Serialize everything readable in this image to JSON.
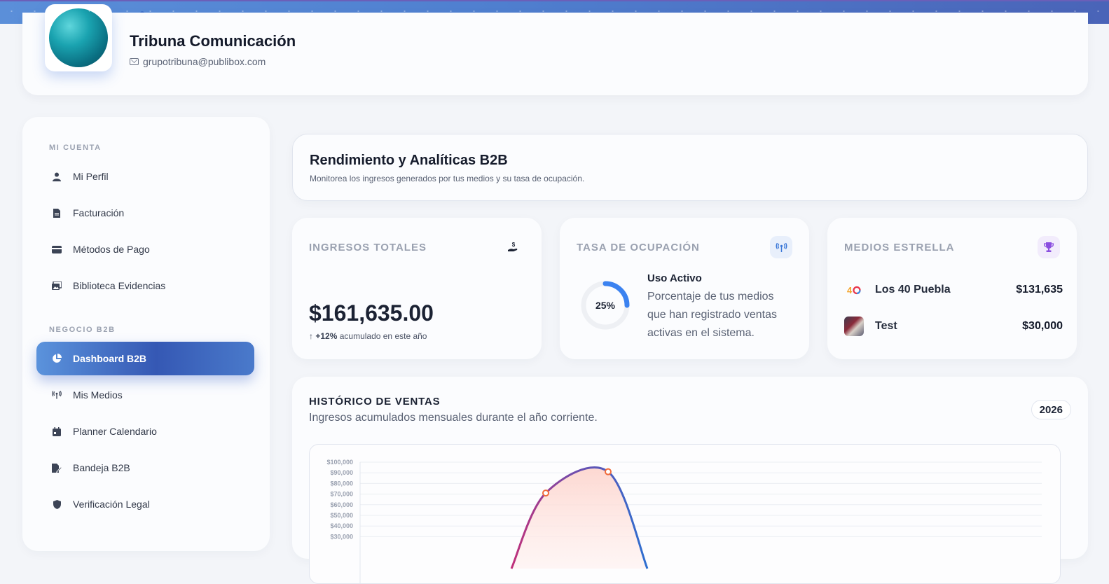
{
  "profile": {
    "name": "Tribuna Comunicación",
    "email": "grupotribuna@publibox.com"
  },
  "sidebar": {
    "sections": [
      {
        "label": "MI CUENTA"
      },
      {
        "label": "NEGOCIO B2B"
      }
    ],
    "items": [
      {
        "label": "Mi Perfil",
        "icon": "user-icon"
      },
      {
        "label": "Facturación",
        "icon": "document-icon"
      },
      {
        "label": "Métodos de Pago",
        "icon": "credit-card-icon"
      },
      {
        "label": "Biblioteca Evidencias",
        "icon": "images-icon"
      },
      {
        "label": "Dashboard B2B",
        "icon": "pie-chart-icon",
        "active": true
      },
      {
        "label": "Mis Medios",
        "icon": "broadcast-icon"
      },
      {
        "label": "Planner Calendario",
        "icon": "calendar-icon"
      },
      {
        "label": "Bandeja B2B",
        "icon": "edit-document-icon"
      },
      {
        "label": "Verificación Legal",
        "icon": "shield-icon"
      }
    ]
  },
  "header": {
    "title": "Rendimiento y Analíticas B2B",
    "subtitle": "Monitorea los ingresos generados por tus medios y su tasa de ocupación."
  },
  "stats": {
    "income": {
      "title": "INGRESOS TOTALES",
      "icon": "hand-money-icon",
      "amount": "$161,635.00",
      "growth_value": "+12%",
      "growth_text": "acumulado en este año"
    },
    "occupancy": {
      "title": "TASA DE OCUPACIÓN",
      "icon": "broadcast-icon",
      "percent_label": "25%",
      "percent_value": 0.25,
      "subtitle": "Uso Activo",
      "description": "Porcentaje de tus medios que han registrado ventas activas en el sistema."
    },
    "stars": {
      "title": "MEDIOS ESTRELLA",
      "icon": "trophy-icon",
      "items": [
        {
          "name": "Los 40 Puebla",
          "value": "$131,635",
          "logo": "40"
        },
        {
          "name": "Test",
          "value": "$30,000",
          "logo": ""
        }
      ]
    }
  },
  "sales": {
    "title": "HISTÓRICO DE VENTAS",
    "subtitle": "Ingresos acumulados mensuales durante el año corriente.",
    "year": "2026"
  },
  "chart_data": {
    "type": "area",
    "title": "",
    "xlabel": "",
    "ylabel": "",
    "ylim": [
      0,
      100000
    ],
    "y_ticks": [
      "$100,000",
      "$90,000",
      "$80,000",
      "$70,000",
      "$60,000",
      "$50,000",
      "$40,000",
      "$30,000"
    ],
    "y_tick_values": [
      100000,
      90000,
      80000,
      70000,
      60000,
      50000,
      40000,
      30000
    ],
    "points": [
      {
        "x": 0.0,
        "y": 0
      },
      {
        "x": 1.0,
        "y": 71000
      },
      {
        "x": 2.0,
        "y": 91000
      },
      {
        "x": 3.0,
        "y": 0
      }
    ],
    "markers": [
      {
        "x": 1.0,
        "y": 71000
      },
      {
        "x": 2.0,
        "y": 91000
      }
    ],
    "grid": true,
    "colors": {
      "line_start": "#c0307a",
      "line_mid": "#6b4fb0",
      "line_end": "#2d6fd0",
      "fill": "#fdd6cf",
      "marker": "#f06a3a"
    }
  }
}
